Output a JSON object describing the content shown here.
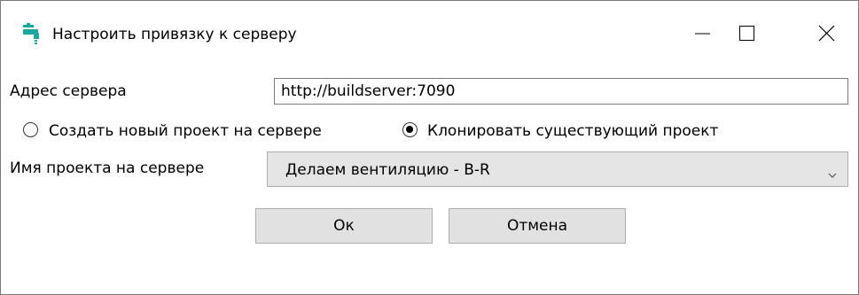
{
  "window": {
    "title": "Настроить привязку к серверу",
    "icon": "faucet-icon",
    "accent_color": "#1aa7a0"
  },
  "form": {
    "server_address_label": "Адрес сервера",
    "server_address_value": "http://buildserver:7090",
    "radio_create_label": "Создать новый проект на сервере",
    "radio_create_selected": false,
    "radio_clone_label": "Клонировать существующий проект",
    "radio_clone_selected": true,
    "project_name_label": "Имя проекта на сервере",
    "project_name_value": "Делаем вентиляцию - В-R"
  },
  "buttons": {
    "ok_label": "Ок",
    "cancel_label": "Отмена"
  }
}
